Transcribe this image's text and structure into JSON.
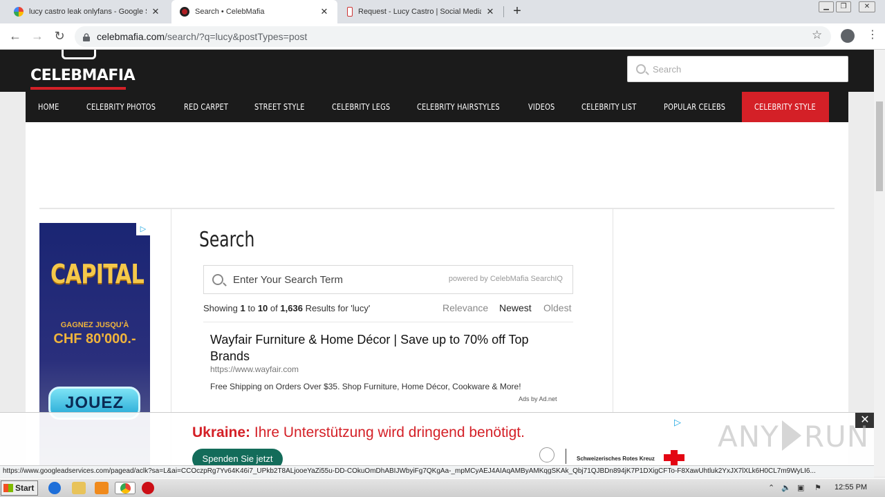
{
  "browser": {
    "tabs": [
      {
        "title": "lucy castro leak onlyfans - Google Se",
        "favicon": "google-icon"
      },
      {
        "title": "Search • CelebMafia",
        "favicon": "celebmafia-icon"
      },
      {
        "title": "Request - Lucy Castro | Social Media",
        "favicon": "site-icon"
      }
    ],
    "new_tab_label": "+",
    "url_host": "celebmafia.com",
    "url_path": "/search/?q=lucy&postTypes=post"
  },
  "site": {
    "logo_text": "CELEBMAFIA",
    "search_placeholder": "Search",
    "nav": [
      "HOME",
      "CELEBRITY PHOTOS",
      "RED CARPET",
      "STREET STYLE",
      "CELEBRITY LEGS",
      "CELEBRITY HAIRSTYLES",
      "VIDEOS",
      "CELEBRITY LIST",
      "POPULAR CELEBS",
      "CELEBRITY STYLE"
    ],
    "accent_color": "#d42027"
  },
  "left_ad": {
    "brand": "CAPITAL",
    "line1": "GAGNEZ JUSQU'À",
    "line2": "CHF 80'000.-",
    "cta": "JOUEZ"
  },
  "search": {
    "title": "Search",
    "placeholder": "Enter Your Search Term",
    "powered_by": "powered by CelebMafia SearchIQ",
    "showing_prefix": "Showing",
    "from": "1",
    "to_word": "to",
    "to": "10",
    "of_word": "of",
    "total": "1,636",
    "suffix": "Results for 'lucy'",
    "sort_options": [
      "Relevance",
      "Newest",
      "Oldest"
    ],
    "sort_selected": "Newest"
  },
  "result": {
    "title": "Wayfair Furniture & Home Décor | Save up to 70% off Top Brands",
    "url": "https://www.wayfair.com",
    "description": "Free Shipping on Orders Over $35. Shop Furniture, Home Décor, Cookware & More!",
    "ads_label": "Ads by Ad.net"
  },
  "bottom_ad": {
    "headline_bold": "Ukraine:",
    "headline_rest": " Ihre Unterstützung wird dringend benötigt.",
    "button": "Spenden Sie jetzt",
    "org": "Schweizerisches Rotes Kreuz",
    "close": "✕"
  },
  "watermark": {
    "left": "ANY",
    "right": "RUN"
  },
  "status_url": "https://www.googleadservices.com/pagead/aclk?sa=L&ai=CCOczpRg7Yv64K46i7_UPkb2T8ALjooeYaZi55u-DD-COkuOmDhABIJWbyiFg7QKgAa-_mpMCyAEJ4AIAqAMByAMKqgSKAk_Qbj71QJBDn894jK7P1DXigCFTo-F8XawUhtluk2YxJX7lXLk6H0CL7m9WyLI6...",
  "taskbar": {
    "start": "Start",
    "clock": "12:55 PM"
  }
}
